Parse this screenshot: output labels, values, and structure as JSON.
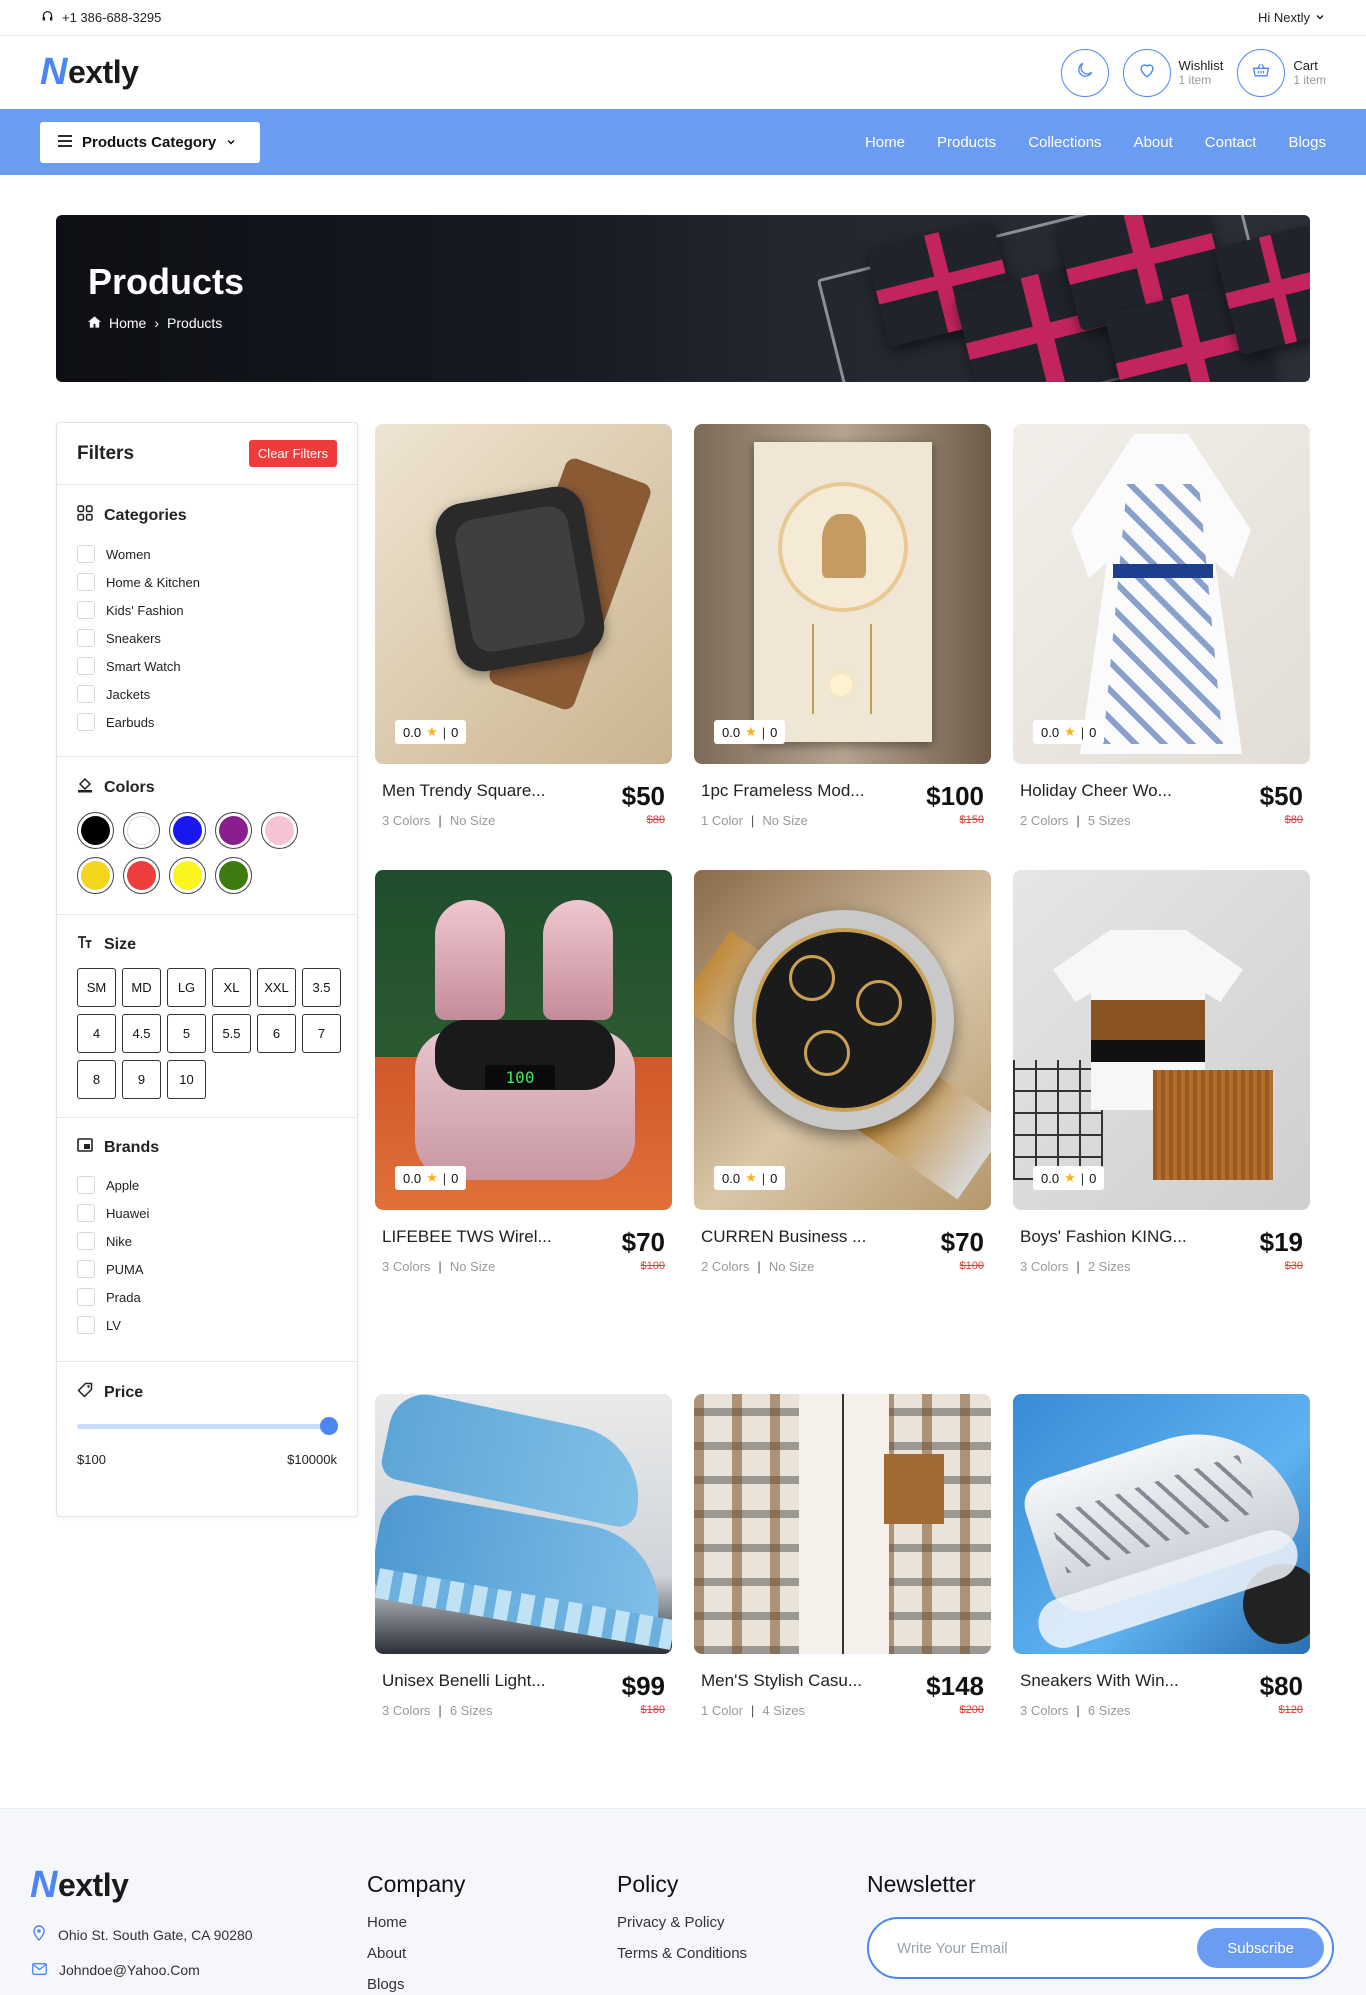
{
  "topbar": {
    "phone": "+1 386-688-3295",
    "greeting": "Hi Nextly"
  },
  "header": {
    "logo_letter": "N",
    "logo_rest": "extly",
    "wishlist_label": "Wishlist",
    "wishlist_count": "1 item",
    "cart_label": "Cart",
    "cart_count": "1 item"
  },
  "nav": {
    "category_button": "Products Category",
    "links": [
      "Home",
      "Products",
      "Collections",
      "About",
      "Contact",
      "Blogs"
    ]
  },
  "banner": {
    "title": "Products",
    "crumb_home": "Home",
    "crumb_current": "Products"
  },
  "filters": {
    "title": "Filters",
    "clear": "Clear Filters",
    "categories_title": "Categories",
    "categories": [
      "Women",
      "Home & Kitchen",
      "Kids' Fashion",
      "Sneakers",
      "Smart Watch",
      "Jackets",
      "Earbuds"
    ],
    "colors_title": "Colors",
    "colors": [
      "#000000",
      "#ffffff",
      "#1a16f0",
      "#8a1e8e",
      "#f5c3d2",
      "#f3d51b",
      "#ee3d3d",
      "#fbf51e",
      "#3d7a10"
    ],
    "size_title": "Size",
    "sizes": [
      "SM",
      "MD",
      "LG",
      "XL",
      "XXL",
      "3.5",
      "4",
      "4.5",
      "5",
      "5.5",
      "6",
      "7",
      "8",
      "9",
      "10"
    ],
    "brands_title": "Brands",
    "brands": [
      "Apple",
      "Huawei",
      "Nike",
      "PUMA",
      "Prada",
      "LV"
    ],
    "price_title": "Price",
    "price_min": "$100",
    "price_max": "$10000k",
    "price_slider_fraction": 1.0
  },
  "products": [
    {
      "name": "Men Trendy Square...",
      "colors": "3 Colors",
      "sizes": "No Size",
      "price": "$50",
      "old_price": "$80",
      "rating": "0.0",
      "reviews": "0"
    },
    {
      "name": "1pc Frameless Mod...",
      "colors": "1 Color",
      "sizes": "No Size",
      "price": "$100",
      "old_price": "$150",
      "rating": "0.0",
      "reviews": "0"
    },
    {
      "name": "Holiday Cheer Wo...",
      "colors": "2 Colors",
      "sizes": "5 Sizes",
      "price": "$50",
      "old_price": "$80",
      "rating": "0.0",
      "reviews": "0"
    },
    {
      "name": "LIFEBEE TWS Wirel...",
      "colors": "3 Colors",
      "sizes": "No Size",
      "price": "$70",
      "old_price": "$100",
      "rating": "0.0",
      "reviews": "0"
    },
    {
      "name": "CURREN Business ...",
      "colors": "2 Colors",
      "sizes": "No Size",
      "price": "$70",
      "old_price": "$100",
      "rating": "0.0",
      "reviews": "0"
    },
    {
      "name": "Boys' Fashion KING...",
      "colors": "3 Colors",
      "sizes": "2 Sizes",
      "price": "$19",
      "old_price": "$30",
      "rating": "0.0",
      "reviews": "0"
    },
    {
      "name": "Unisex Benelli Light...",
      "colors": "3 Colors",
      "sizes": "6 Sizes",
      "price": "$99",
      "old_price": "$180",
      "rating": "",
      "reviews": ""
    },
    {
      "name": "Men'S Stylish Casu...",
      "colors": "1 Color",
      "sizes": "4 Sizes",
      "price": "$148",
      "old_price": "$200",
      "rating": "",
      "reviews": ""
    },
    {
      "name": "Sneakers With Win...",
      "colors": "3 Colors",
      "sizes": "6 Sizes",
      "price": "$80",
      "old_price": "$120",
      "rating": "",
      "reviews": ""
    }
  ],
  "footer": {
    "address": "Ohio St. South Gate, CA 90280",
    "email": "Johndoe@Yahoo.Com",
    "company_title": "Company",
    "company_links": [
      "Home",
      "About",
      "Blogs"
    ],
    "policy_title": "Policy",
    "policy_links": [
      "Privacy & Policy",
      "Terms & Conditions"
    ],
    "newsletter_title": "Newsletter",
    "email_placeholder": "Write Your Email",
    "subscribe": "Subscribe"
  }
}
